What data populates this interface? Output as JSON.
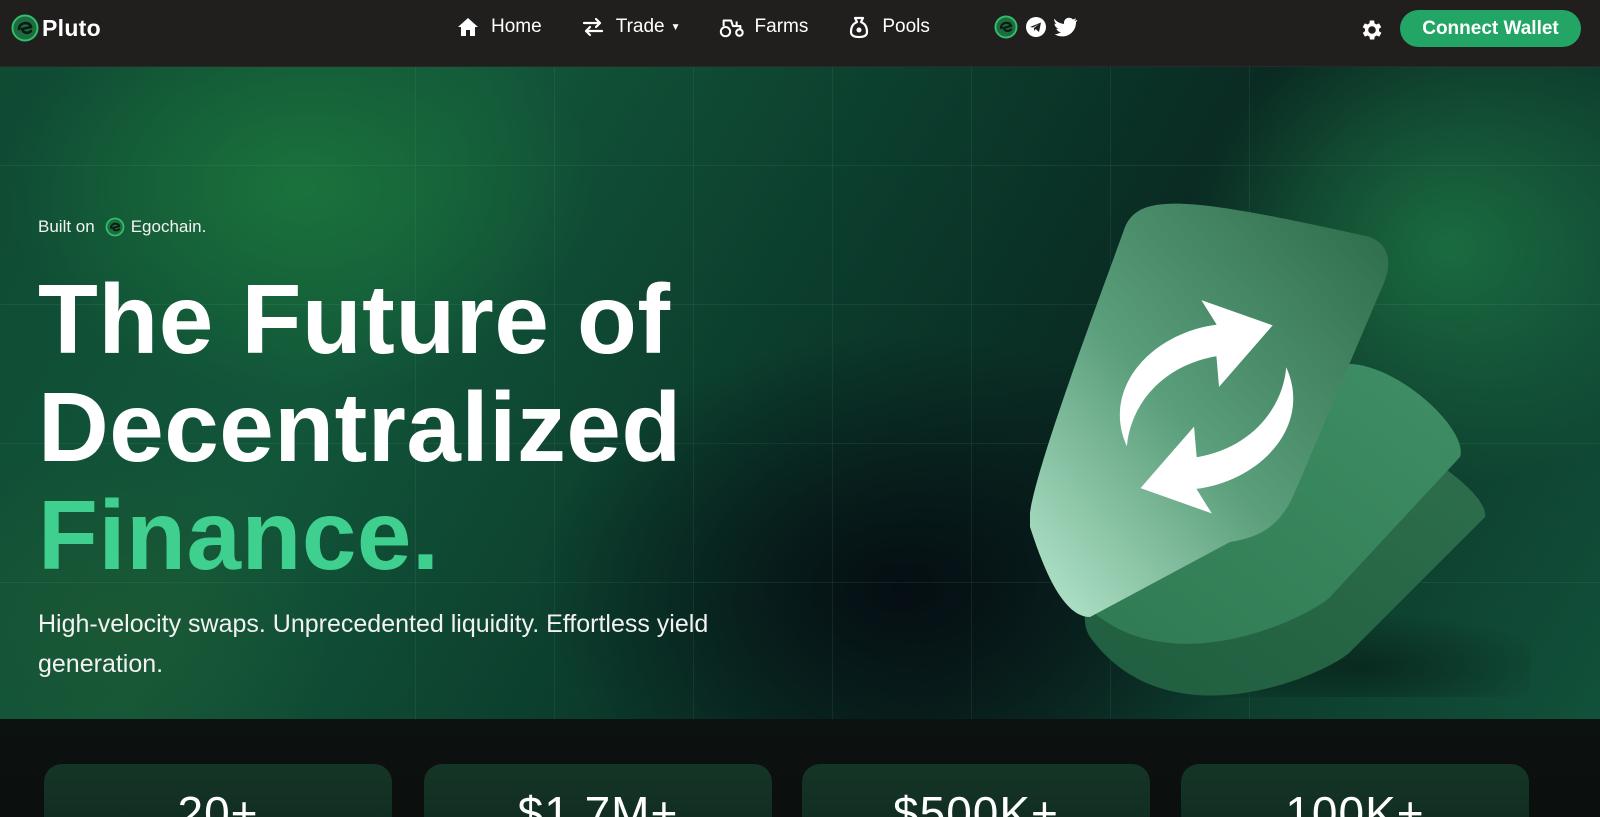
{
  "brand": {
    "name": "Pluto"
  },
  "nav": {
    "items": [
      {
        "label": "Home",
        "icon": "home-icon"
      },
      {
        "label": "Trade",
        "icon": "swap-arrows-icon",
        "has_dropdown": true
      },
      {
        "label": "Farms",
        "icon": "tractor-icon"
      },
      {
        "label": "Pools",
        "icon": "pool-bag-icon"
      }
    ],
    "socials": [
      "egochain-icon",
      "telegram-icon",
      "twitter-icon"
    ],
    "settings_icon": "gear-icon",
    "connect_label": "Connect Wallet"
  },
  "hero": {
    "built_on_prefix": "Built on",
    "chain_name": "Egochain.",
    "headline_line1": "The Future of",
    "headline_line2": "Decentralized",
    "headline_accent": "Finance.",
    "subtitle": "High-velocity swaps. Unprecedented liquidity. Effortless yield generation."
  },
  "stats": [
    {
      "value": "20+"
    },
    {
      "value": "$1.7M+"
    },
    {
      "value": "$500K+"
    },
    {
      "value": "100K+"
    }
  ],
  "colors": {
    "accent": "#3fcf8e",
    "button": "#22a565",
    "navbar": "#211e1e"
  }
}
